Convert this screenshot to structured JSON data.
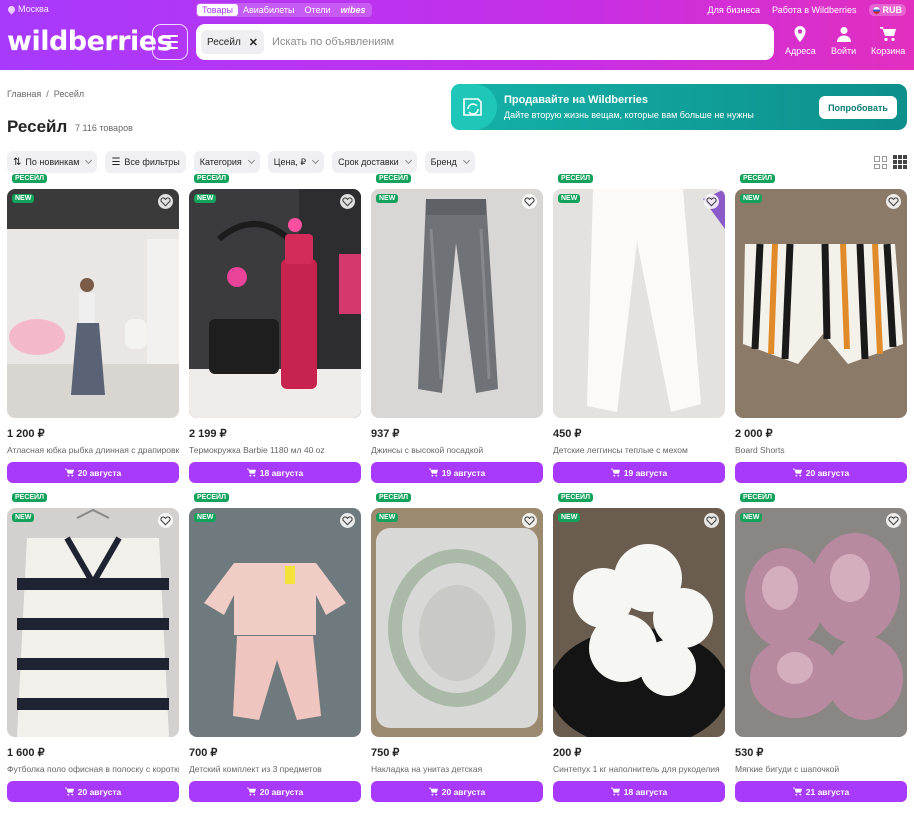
{
  "header": {
    "location": "Москва",
    "tabs": [
      "Товары",
      "Авиабилеты",
      "Отели",
      "wibes"
    ],
    "business_link": "Для бизнеса",
    "work_link": "Работа в Wildberries",
    "currency": "RUB",
    "logo": "wildberries",
    "search_chip": "Ресейл",
    "search_placeholder": "Искать по объявлениям",
    "nav": {
      "addresses": "Адреса",
      "login": "Войти",
      "cart": "Корзина"
    }
  },
  "breadcrumb": [
    "Главная",
    "Ресейл"
  ],
  "page": {
    "title": "Ресейл",
    "count": "7 116 товаров"
  },
  "banner": {
    "title": "Продавайте на Wildberries",
    "subtitle": "Дайте вторую жизнь вещам, которые вам больше не нужны",
    "button": "Попробовать"
  },
  "filters": [
    "По новинкам",
    "Все фильтры",
    "Категория",
    "Цена, ₽",
    "Срок доставки",
    "Бренд"
  ],
  "badges": {
    "new": "NEW",
    "resale": "РЕСЕЙЛ"
  },
  "colors": {
    "accent": "#a73afd",
    "badge": "#13a25c",
    "banner": "#14b1a8"
  },
  "products": [
    {
      "price": "1 200 ₽",
      "name": "Атласная юбка рыбка длинная с драпировкой",
      "delivery": "20 августа"
    },
    {
      "price": "2 199 ₽",
      "name": "Термокружка Barbie 1180 мл 40 oz",
      "delivery": "18 августа"
    },
    {
      "price": "937 ₽",
      "name": "Джинсы с высокой посадкой",
      "delivery": "19 августа"
    },
    {
      "price": "450 ₽",
      "name": "Детские леггинсы теплые с мехом",
      "delivery": "19 августа"
    },
    {
      "price": "2 000 ₽",
      "name": "Board Shorts",
      "delivery": "20 августа"
    },
    {
      "price": "1 600 ₽",
      "name": "Футболка поло офисная в полоску с коротким рукавом",
      "delivery": "20 августа"
    },
    {
      "price": "700 ₽",
      "name": "Детский комплект из 3 предметов",
      "delivery": "20 августа"
    },
    {
      "price": "750 ₽",
      "name": "Накладка на унитаз детская",
      "delivery": "20 августа"
    },
    {
      "price": "200 ₽",
      "name": "Синтепух 1 кг наполнитель для рукоделия",
      "delivery": "18 августа"
    },
    {
      "price": "530 ₽",
      "name": "Мягкие бигуди с шапочкой",
      "delivery": "21 августа"
    }
  ]
}
